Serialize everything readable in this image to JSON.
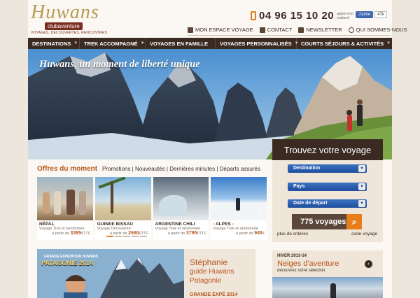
{
  "brand": {
    "name": "Huwans",
    "badge": "clubaventure",
    "tagline": "VOYAGES, DÉCOUVERTES, RENCONTRES"
  },
  "contact": {
    "phone": "04 96 15 10 20",
    "cost_note": "appel non surtaxé"
  },
  "facebook": {
    "like_label": "J'aime",
    "count": "47k"
  },
  "toplinks": [
    {
      "label": "MON ESPACE VOYAGE",
      "icon": "user-icon"
    },
    {
      "label": "CONTACT",
      "icon": "envelope-icon"
    },
    {
      "label": "NEWSLETTER",
      "icon": "newsletter-icon"
    },
    {
      "label": "QUI SOMMES-NOUS",
      "icon": "question-icon"
    }
  ],
  "nav": [
    {
      "label": "DESTINATIONS"
    },
    {
      "label": "TREK ACCOMPAGNÉ"
    },
    {
      "label": "VOYAGES EN FAMILLE"
    },
    {
      "label": "VOYAGES PERSONNALISÉS"
    },
    {
      "label": "COURTS SÉJOURS & ACTIVITÉS"
    }
  ],
  "hero": {
    "caption": "Huwans, un moment de liberté unique"
  },
  "search": {
    "title": "Trouvez votre voyage",
    "destination": "Destination",
    "country": "Pays",
    "date": "Date de départ",
    "results": "775 voyages",
    "more_criteria": "plus de critères",
    "code": "code voyage"
  },
  "offers": {
    "title": "Offres du moment",
    "tabs": "Promotions | Nouveautés | Dernières minutes | Départs assurés",
    "cards": [
      {
        "title": "NÉPAL",
        "sub": "Voyage Trek et randonnée",
        "price_prefix": "à partir de",
        "price": "3395",
        "unit": "€TTC"
      },
      {
        "title": "GUINEE BISSAU",
        "sub": "Voyage Découverte",
        "price_prefix": "à partir de",
        "price": "2690",
        "unit": "€TTC"
      },
      {
        "title": "ARGENTINE CHILI",
        "sub": "Voyage Trek et randonnée",
        "price_prefix": "à partir de",
        "price": "3795",
        "unit": "€TTC"
      },
      {
        "title": "- ALPES -",
        "sub": "Voyage Trek et randonnée",
        "price_prefix": "à partir de",
        "price": "945",
        "unit": "€"
      }
    ]
  },
  "promo": {
    "label_top": "GRANDE EXPÉDITION HUWANS",
    "label_main": "PATAGONIE 2014",
    "name": "Stéphanie",
    "guide": "guide Huwans",
    "region": "Patagonie",
    "footer": "GRANDE EXPÉ 2014"
  },
  "winter": {
    "eyebrow": "HIVER 2013-14",
    "title": "Neiges d'aventure",
    "subtitle": "découvrez notre sélection"
  }
}
